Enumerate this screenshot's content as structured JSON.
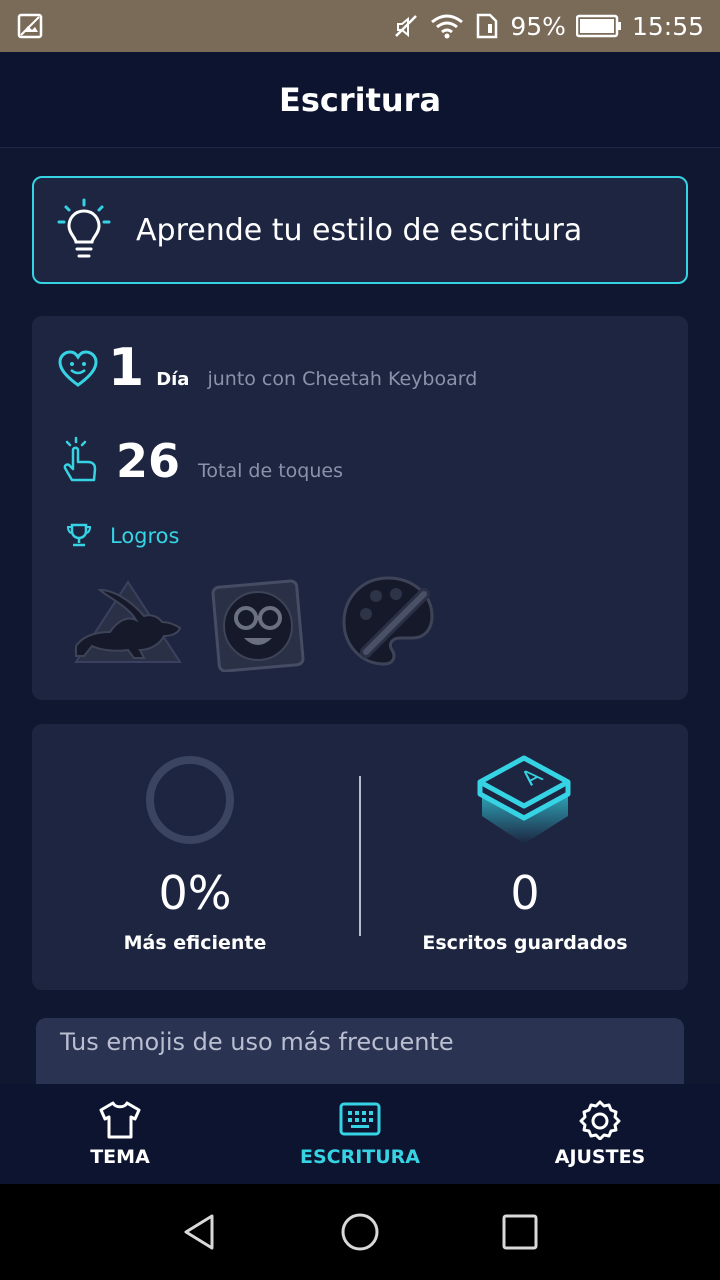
{
  "status_bar": {
    "battery": "95%",
    "time": "15:55"
  },
  "header": {
    "title": "Escritura"
  },
  "learn_banner": {
    "label": "Aprende tu estilo de escritura"
  },
  "stats": {
    "days": {
      "value": "1",
      "unit": "Día",
      "caption": "junto con Cheetah Keyboard"
    },
    "taps": {
      "value": "26",
      "caption": "Total de toques"
    },
    "achievements_label": "Logros",
    "achievements": [
      "rabbit-badge",
      "nerd-face-badge",
      "palette-badge"
    ]
  },
  "efficiency": {
    "percent_value": "0%",
    "percent_label": "Más eficiente",
    "saved_value": "0",
    "saved_label": "Escritos guardados"
  },
  "emoji_section": {
    "title": "Tus emojis de uso más frecuente"
  },
  "bottom_nav": {
    "items": [
      {
        "label": "TEMA",
        "icon": "shirt-icon",
        "active": false
      },
      {
        "label": "ESCRITURA",
        "icon": "keyboard-icon",
        "active": true
      },
      {
        "label": "AJUSTES",
        "icon": "gear-icon",
        "active": false
      }
    ]
  },
  "colors": {
    "accent": "#35d3e3",
    "background": "#101731",
    "card": "#1d2540"
  }
}
